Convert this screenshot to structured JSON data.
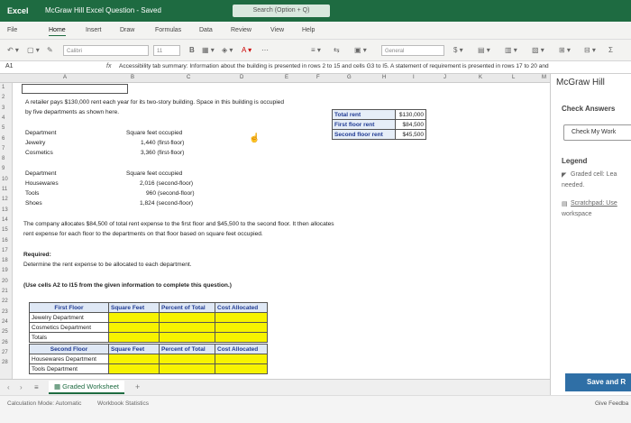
{
  "titlebar": {
    "app": "Excel",
    "doc_title": "McGraw Hill Excel Question - Saved",
    "search_placeholder": "Search (Option + Q)"
  },
  "tabs": [
    "File",
    "Home",
    "Insert",
    "Draw",
    "Formulas",
    "Data",
    "Review",
    "View",
    "Help"
  ],
  "active_tab": "Home",
  "ribbon": {
    "font": "Calibri",
    "size": "11",
    "number_format": "General"
  },
  "formula_bar": {
    "namebox": "A1",
    "fx": "fx",
    "content": "Accessibility tab summary: Information about the building is presented in rows 2 to 15 and cells G3 to I5. A statement of requirement is presented in rows 17 to 20 and"
  },
  "columns": [
    "A",
    "B",
    "C",
    "D",
    "E",
    "F",
    "G",
    "H",
    "I",
    "J",
    "K",
    "L",
    "M"
  ],
  "rows": [
    "1",
    "2",
    "3",
    "4",
    "5",
    "6",
    "7",
    "8",
    "9",
    "10",
    "11",
    "12",
    "13",
    "14",
    "15",
    "16",
    "17",
    "18",
    "19",
    "20",
    "21",
    "22",
    "23",
    "24",
    "25",
    "26",
    "27",
    "28"
  ],
  "cells": {
    "r2": "A retailer pays $130,000 rent each year for its two-story building. Space in this building is occupied",
    "r3": "by five departments as shown here.",
    "dept_header": "Department",
    "sqft_header": "Square feet occupied",
    "first_floor": [
      {
        "dept": "Jewelry",
        "sqft": "1,440 (first-floor)"
      },
      {
        "dept": "Cosmetics",
        "sqft": "3,360 (first-floor)"
      }
    ],
    "second_floor": [
      {
        "dept": "Housewares",
        "sqft": "2,016 (second-floor)"
      },
      {
        "dept": "Tools",
        "sqft": "960 (second-floor)"
      },
      {
        "dept": "Shoes",
        "sqft": "1,824 (second-floor)"
      }
    ],
    "r14": "The company allocates $84,500 of total rent expense to the first floor and $45,500 to the second floor. It then allocates",
    "r15": "rent expense for each floor to the departments on that floor based on square feet occupied.",
    "r17": "Required:",
    "r18": "Determine the rent expense to be allocated to each department.",
    "r20": "(Use cells A2 to I15 from the given information to complete this question.)"
  },
  "rent_table": [
    {
      "label": "Total rent",
      "value": "$130,000"
    },
    {
      "label": "First floor rent",
      "value": "$84,500"
    },
    {
      "label": "Second floor rent",
      "value": "$45,500"
    }
  ],
  "answer_tables": {
    "headers": [
      "Square Feet",
      "Percent of Total",
      "Cost Allocated"
    ],
    "first_floor_title": "First Floor",
    "first_floor_rows": [
      "Jewelry Department",
      "Cosmetics Department",
      "Totals"
    ],
    "second_floor_title": "Second Floor",
    "second_floor_rows": [
      "Housewares Department",
      "Tools Department"
    ]
  },
  "sheet_tab": "Graded Worksheet",
  "status": {
    "calc_mode": "Calculation Mode: Automatic",
    "stats": "Workbook Statistics"
  },
  "panel": {
    "title": "McGraw Hill",
    "check_answers": "Check Answers",
    "check_my_work": "Check My Work",
    "legend": "Legend",
    "graded_cell": "Graded cell: Lea",
    "needed": "needed.",
    "scratchpad": "Scratchpad: Use",
    "workspace": "workspace",
    "save": "Save and R",
    "feedback": "Give Feedba"
  },
  "colors": {
    "excel_green": "#1e6b41",
    "graded_yellow": "#f7f300",
    "save_blue": "#2f6fa6",
    "header_blue": "#1f3a93"
  }
}
